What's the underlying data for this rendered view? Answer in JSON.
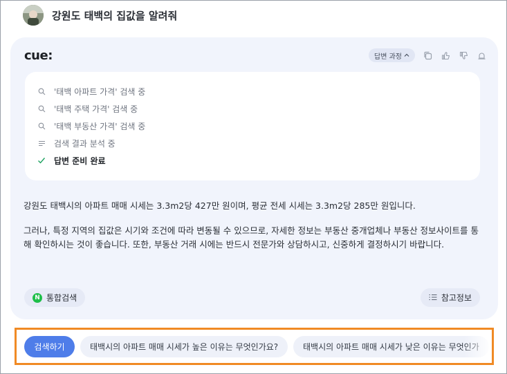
{
  "query": {
    "text": "강원도 태백의 집값을 알려줘"
  },
  "answer": {
    "logo_text": "cue",
    "logo_colon": ":",
    "process_label": "답변 과정",
    "steps": [
      {
        "icon": "search-icon",
        "label": "'태백 아파트 가격' 검색 중"
      },
      {
        "icon": "search-icon",
        "label": "'태백 주택 가격' 검색 중"
      },
      {
        "icon": "search-icon",
        "label": "'태백 부동산 가격' 검색 중"
      },
      {
        "icon": "lines-icon",
        "label": "검색 결과 분석 중"
      },
      {
        "icon": "check-icon",
        "label": "답변 준비 완료"
      }
    ],
    "paragraph1": "강원도 태백시의 아파트 매매 시세는 3.3m2당 427만 원이며, 평균 전세 시세는 3.3m2당 285만 원입니다.",
    "paragraph2": "그러나, 특정 지역의 집값은 시기와 조건에 따라 변동될 수 있으므로, 자세한 정보는 부동산 중개업체나 부동산 정보사이트를 통해 확인하시는 것이 좋습니다. 또한, 부동산 거래 시에는 반드시 전문가와 상담하시고, 신중하게 결정하시기 바랍니다.",
    "integrated_search_label": "통합검색",
    "references_label": "참고정보"
  },
  "suggestions": {
    "search_button": "검색하기",
    "chips": [
      "태백시의 아파트 매매 시세가 높은 이유는 무엇인가요?",
      "태백시의 아파트 매매 시세가 낮은 이유는 무엇인가"
    ]
  },
  "colors": {
    "accent": "#4e7de9",
    "highlight_border": "#f08a24",
    "card_bg": "#f1f4fc",
    "naver_green": "#1fbf4a"
  }
}
